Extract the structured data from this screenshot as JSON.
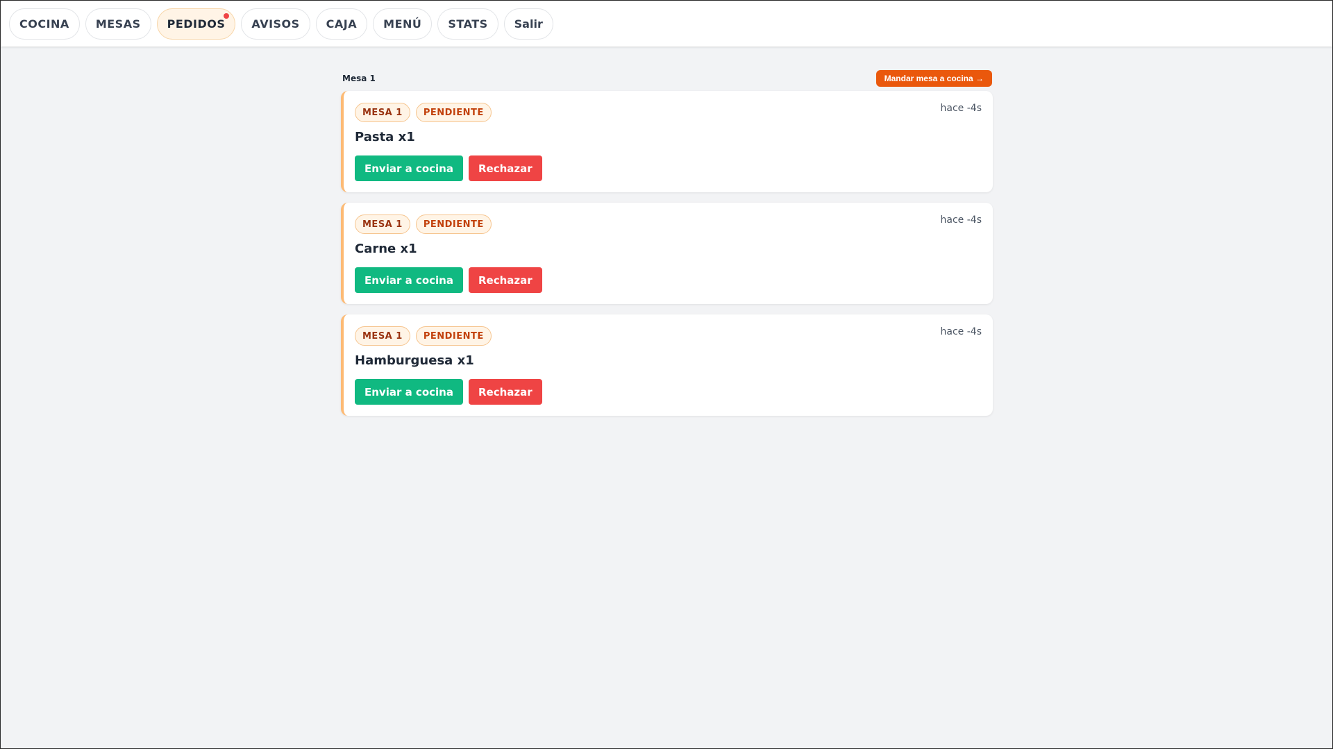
{
  "nav": {
    "tabs": [
      {
        "label": "COCINA",
        "active": false
      },
      {
        "label": "MESAS",
        "active": false
      },
      {
        "label": "PEDIDOS",
        "active": true,
        "notification": true
      },
      {
        "label": "AVISOS",
        "active": false
      },
      {
        "label": "CAJA",
        "active": false
      },
      {
        "label": "MENÚ",
        "active": false
      },
      {
        "label": "STATS",
        "active": false
      },
      {
        "label": "Salir",
        "active": false
      }
    ]
  },
  "group": {
    "title": "Mesa 1",
    "send_table_label": "Mandar mesa a cocina →"
  },
  "orders": [
    {
      "table": "MESA 1",
      "status": "PENDIENTE",
      "time": "hace -4s",
      "item": "Pasta x1",
      "send_label": "Enviar a cocina",
      "reject_label": "Rechazar"
    },
    {
      "table": "MESA 1",
      "status": "PENDIENTE",
      "time": "hace -4s",
      "item": "Carne x1",
      "send_label": "Enviar a cocina",
      "reject_label": "Rechazar"
    },
    {
      "table": "MESA 1",
      "status": "PENDIENTE",
      "time": "hace -4s",
      "item": "Hamburguesa x1",
      "send_label": "Enviar a cocina",
      "reject_label": "Rechazar"
    }
  ],
  "colors": {
    "accent": "#ea580c",
    "send": "#10b981",
    "reject": "#ef4444",
    "pending_border": "#fdba74",
    "notification": "#ef4444"
  }
}
